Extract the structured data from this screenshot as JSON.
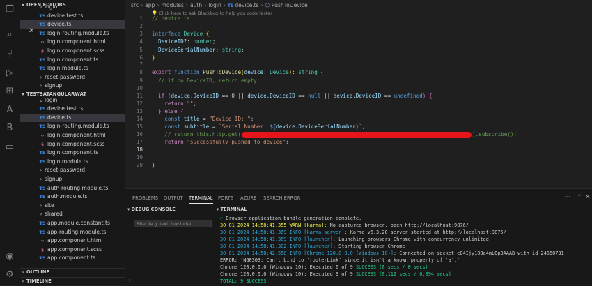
{
  "sidebar": {
    "open_editors_title": "OPEN EDITORS",
    "open_editors": [
      {
        "label": "login",
        "kind": "folder"
      },
      {
        "label": "device.test.ts",
        "kind": "ts"
      },
      {
        "label": "device.ts",
        "kind": "ts",
        "selected": true
      },
      {
        "label": "login-routing.module.ts",
        "kind": "ts"
      },
      {
        "label": "login.component.html",
        "kind": "html"
      },
      {
        "label": "login.component.scss",
        "kind": "scss"
      },
      {
        "label": "login.component.ts",
        "kind": "ts"
      },
      {
        "label": "login.module.ts",
        "kind": "ts"
      },
      {
        "label": "reset-password",
        "kind": "folder"
      },
      {
        "label": "signup",
        "kind": "folder"
      }
    ],
    "project_title": "TESTSATANGULARWAT",
    "project_items": [
      {
        "label": "login",
        "kind": "folder-open"
      },
      {
        "label": "device.test.ts",
        "kind": "ts"
      },
      {
        "label": "device.ts",
        "kind": "ts",
        "selected": true
      },
      {
        "label": "login-routing.module.ts",
        "kind": "ts"
      },
      {
        "label": "login.component.html",
        "kind": "html"
      },
      {
        "label": "login.component.scss",
        "kind": "scss"
      },
      {
        "label": "login.component.ts",
        "kind": "ts"
      },
      {
        "label": "login.module.ts",
        "kind": "ts"
      },
      {
        "label": "reset-password",
        "kind": "folder"
      },
      {
        "label": "signup",
        "kind": "folder"
      },
      {
        "label": "auth-routing.module.ts",
        "kind": "ts"
      },
      {
        "label": "auth.module.ts",
        "kind": "ts"
      },
      {
        "label": "site",
        "kind": "folder"
      },
      {
        "label": "shared",
        "kind": "folder"
      },
      {
        "label": "app.module.constant.ts",
        "kind": "ts"
      },
      {
        "label": "app-routing.module.ts",
        "kind": "ts"
      },
      {
        "label": "app.component.html",
        "kind": "html"
      },
      {
        "label": "app.component.scss",
        "kind": "scss"
      },
      {
        "label": "app.component.ts",
        "kind": "ts"
      }
    ],
    "outline_title": "OUTLINE",
    "timeline_title": "TIMELINE"
  },
  "editor": {
    "breadcrumbs": [
      "src",
      "app",
      "modules",
      "auth",
      "login",
      "device.ts",
      "PushToDevice"
    ],
    "hint": "Click here to ask Blackbox to help you code faster",
    "lines": [
      {
        "n": "1",
        "text": "// device.ts"
      },
      {
        "n": "2",
        "text": ""
      },
      {
        "n": "3",
        "text": "interface Device {"
      },
      {
        "n": "4",
        "text": "  DeviceID?: number;"
      },
      {
        "n": "5",
        "text": "  DeviceSerialNumber: string;"
      },
      {
        "n": "6",
        "text": "}"
      },
      {
        "n": "7",
        "text": ""
      },
      {
        "n": "8",
        "text": "export function PushToDevice(device: Device): string {"
      },
      {
        "n": "9",
        "text": "  // if no DeviceID, return empty"
      },
      {
        "n": "10",
        "text": ""
      },
      {
        "n": "11",
        "text": "  if (device.DeviceID == 0 || device.DeviceID == null || device.DeviceID == undefined) {"
      },
      {
        "n": "12",
        "text": "    return \"\";"
      },
      {
        "n": "13",
        "text": "  } else {"
      },
      {
        "n": "14",
        "text": "    const title = \"Device ID: \";"
      },
      {
        "n": "15",
        "text": "    const subtitle = `Serial Number: ${device.DeviceSerialNumber}`;"
      },
      {
        "n": "16",
        "text": "    // return this.http.get(                                ).subscribe();"
      },
      {
        "n": "17",
        "text": "    return \"successfully pushed to device\";"
      },
      {
        "n": "18",
        "text": ""
      },
      {
        "n": "19",
        "text": ""
      },
      {
        "n": "20",
        "text": "}"
      }
    ],
    "current_line": "18"
  },
  "panel": {
    "tabs": [
      "PROBLEMS",
      "OUTPUT",
      "TERMINAL",
      "PORTS",
      "AZURE",
      "SEARCH ERROR"
    ],
    "active_tab": "TERMINAL",
    "debug_console_title": "DEBUG CONSOLE",
    "filter_placeholder": "Filter (e.g. text, !exclude)",
    "terminal_title": "TERMINAL",
    "terminal_lines": [
      {
        "prefix": "✓",
        "text": " Browser application bundle generation complete."
      },
      {
        "prefix": "30 01 2024 14:58:41.355:WARN [karma]",
        "text": ": No captured browser, open http://localhost:9876/"
      },
      {
        "prefix": "30 01 2024 14:58:41.369:INFO [karma-server]",
        "text": ": Karma v6.3.20 server started at http://localhost:9876/"
      },
      {
        "prefix": "30 01 2024 14:58:41.369:INFO [launcher]",
        "text": ": Launching browsers Chrome with concurrency unlimited"
      },
      {
        "prefix": "30 01 2024 14:58:41.382:INFO [launcher]",
        "text": ": Starting browser Chrome"
      },
      {
        "prefix": "30 01 2024 14:58:42.558:INFO [Chrome 120.0.0.0 (Windows 10)]",
        "text": ": Connected on socket eO4Ijy10Oa4mLOpBAAAB with id 24650731"
      },
      {
        "prefix": "ERROR: 'NG0303: Can't bind to 'routerLink' since it isn't a known property of 'a'.'",
        "text": ""
      },
      {
        "prefix": "Chrome 120.0.0.0 (Windows 10): Executed 0 of 9 ",
        "text": "SUCCESS (0 secs / 0 secs)"
      },
      {
        "prefix": "Chrome 120.0.0.0 (Windows 10): Executed 9 of 9 ",
        "text": "SUCCESS (0.112 secs / 0.094 secs)"
      },
      {
        "prefix": "TOTAL: 9 SUCCESS",
        "text": ""
      }
    ]
  },
  "colors": {
    "accent": "#0078d4",
    "warn": "#f5f543",
    "success": "#23d18b",
    "redaction": "#e8141c"
  }
}
